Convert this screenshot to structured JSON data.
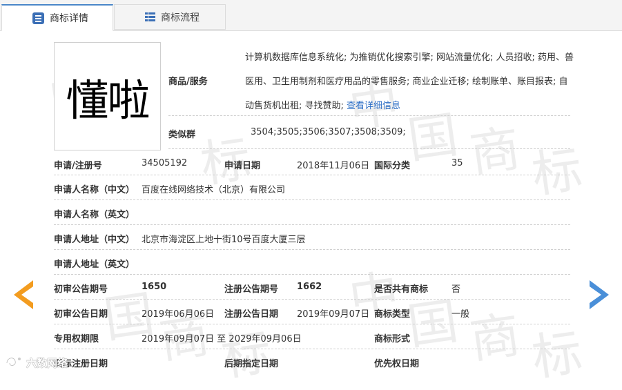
{
  "tabs": [
    {
      "label": "商标详情",
      "active": true,
      "icon": "document-icon"
    },
    {
      "label": "商标流程",
      "active": false,
      "icon": "list-icon"
    }
  ],
  "trademark": {
    "logo_text": "懂啦",
    "goods_label": "商品/服务",
    "goods_text": "计算机数据库信息系统化; 为推销优化搜索引擎; 网站流量优化; 人员招收; 药用、兽医用、卫生用制剂和医疗用品的零售服务; 商业企业迁移; 绘制账单、账目报表; 自动售货机出租; 寻找赞助; ",
    "goods_link": "查看详细信息",
    "similar_label": "类似群",
    "similar_value": "3504;3505;3506;3507;3508;3509;"
  },
  "details": {
    "reg_no_label": "申请/注册号",
    "reg_no": "34505192",
    "apply_date_label": "申请日期",
    "apply_date": "2018年11月06日",
    "intl_class_label": "国际分类",
    "intl_class": "35",
    "applicant_cn_label": "申请人名称（中文）",
    "applicant_cn": "百度在线网络技术（北京）有限公司",
    "applicant_en_label": "申请人名称（英文）",
    "applicant_en": "",
    "address_cn_label": "申请人地址（中文）",
    "address_cn": "北京市海淀区上地十街10号百度大厦三层",
    "address_en_label": "申请人地址（英文）",
    "address_en": "",
    "prelim_no_label": "初审公告期号",
    "prelim_no": "1650",
    "reg_notice_no_label": "注册公告期号",
    "reg_notice_no": "1662",
    "shared_label": "是否共有商标",
    "shared": "否",
    "prelim_date_label": "初审公告日期",
    "prelim_date": "2019年06月06日",
    "reg_notice_date_label": "注册公告日期",
    "reg_notice_date": "2019年09月07日",
    "type_label": "商标类型",
    "type": "一般",
    "exclusive_label": "专用权期限",
    "exclusive": "2019年09月07日 至 2029年09月06日",
    "form_label": "商标形式",
    "form": "",
    "intl_reg_date_label": "国际注册日期",
    "intl_reg_date": "",
    "later_date_label": "后期指定日期",
    "later_date": "",
    "priority_date_label": "优先权日期",
    "priority_date": ""
  },
  "nav": {
    "prev_icon": "arrow-left-icon",
    "next_icon": "arrow-right-icon",
    "prev_color": "#f39c1f",
    "next_color": "#4a8fd8"
  },
  "watermark": {
    "chars": [
      "中",
      "国",
      "商",
      "标"
    ]
  },
  "footer_logo": "六数网络"
}
